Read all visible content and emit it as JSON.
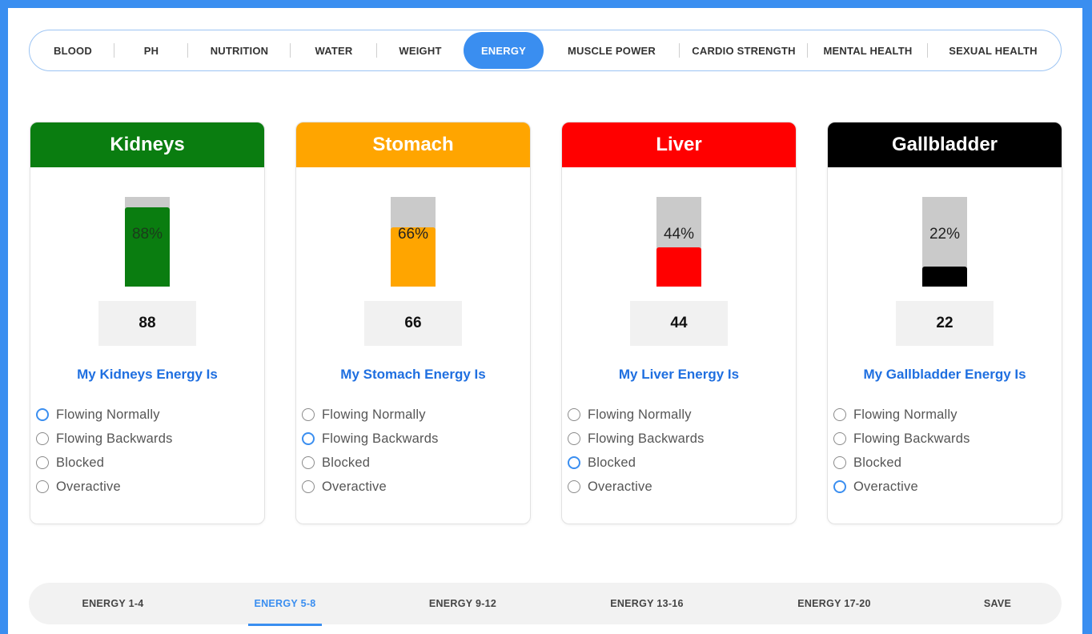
{
  "top_tabs": [
    {
      "label": "BLOOD"
    },
    {
      "label": "PH"
    },
    {
      "label": "NUTRITION"
    },
    {
      "label": "WATER"
    },
    {
      "label": "WEIGHT"
    },
    {
      "label": "ENERGY",
      "active": true
    },
    {
      "label": "MUSCLE POWER"
    },
    {
      "label": "CARDIO STRENGTH"
    },
    {
      "label": "MENTAL HEALTH"
    },
    {
      "label": "SEXUAL HEALTH"
    }
  ],
  "cards": [
    {
      "title": "Kidneys",
      "color": "#0a7d10",
      "label_color": "#1b3b1b",
      "percent": 88,
      "percent_text": "88%",
      "value": "88",
      "question": "My Kidneys Energy Is",
      "options": [
        "Flowing Normally",
        "Flowing Backwards",
        "Blocked",
        "Overactive"
      ],
      "selected": 0
    },
    {
      "title": "Stomach",
      "color": "#ffa500",
      "label_color": "#222222",
      "percent": 66,
      "percent_text": "66%",
      "value": "66",
      "question": "My Stomach Energy Is",
      "options": [
        "Flowing Normally",
        "Flowing Backwards",
        "Blocked",
        "Overactive"
      ],
      "selected": 1
    },
    {
      "title": "Liver",
      "color": "#ff0000",
      "label_color": "#222222",
      "percent": 44,
      "percent_text": "44%",
      "value": "44",
      "question": "My Liver Energy Is",
      "options": [
        "Flowing Normally",
        "Flowing Backwards",
        "Blocked",
        "Overactive"
      ],
      "selected": 2
    },
    {
      "title": "Gallbladder",
      "color": "#000000",
      "label_color": "#222222",
      "percent": 22,
      "percent_text": "22%",
      "value": "22",
      "question": "My Gallbladder Energy Is",
      "options": [
        "Flowing Normally",
        "Flowing Backwards",
        "Blocked",
        "Overactive"
      ],
      "selected": 3
    }
  ],
  "bottom_nav": [
    {
      "label": "ENERGY 1-4"
    },
    {
      "label": "ENERGY 5-8",
      "active": true
    },
    {
      "label": "ENERGY 9-12"
    },
    {
      "label": "ENERGY 13-16"
    },
    {
      "label": "ENERGY 17-20"
    },
    {
      "label": "SAVE"
    }
  ],
  "colors": {
    "accent": "#3a8ef0",
    "question_text": "#1f6fe0"
  }
}
